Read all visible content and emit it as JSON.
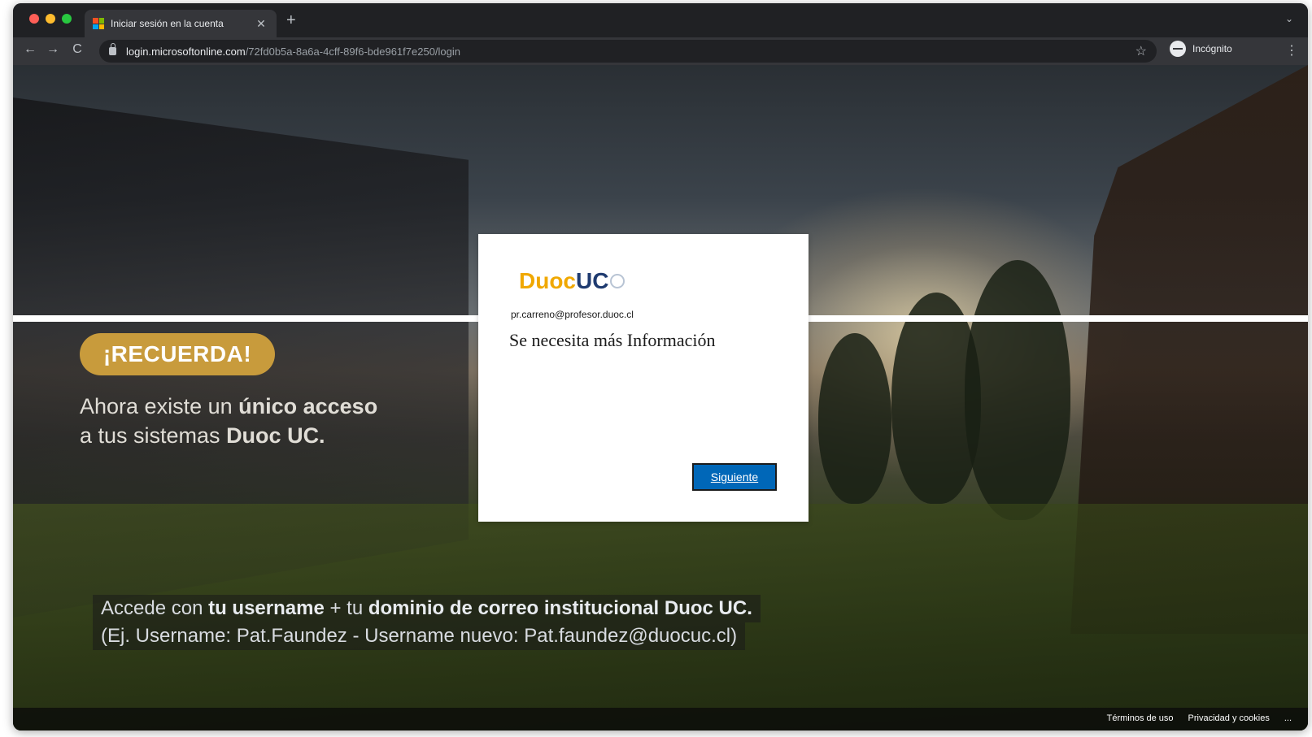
{
  "browser": {
    "tab_title": "Iniciar sesión en la cuenta",
    "tab_close": "✕",
    "new_tab": "+",
    "tab_menu": "⌄",
    "url_host": "login.microsoftonline.com",
    "url_path": "/72fd0b5a-8a6a-4cff-89f6-bde961f7e250/login",
    "incognito_label": "Incógnito",
    "back": "←",
    "forward": "→",
    "reload": "C",
    "star": "☆",
    "menu": "⋮"
  },
  "page": {
    "recuerda": "¡RECUERDA!",
    "tagline_line1_a": "Ahora existe un ",
    "tagline_line1_b": "único acceso",
    "tagline_line2_a": "a tus sistemas ",
    "tagline_line2_b": "Duoc UC.",
    "bottom_line1_a": "Accede con ",
    "bottom_line1_b": "tu username",
    "bottom_line1_c": " + tu ",
    "bottom_line1_d": "dominio de correo institucional Duoc UC.",
    "bottom_line2": "(Ej. Username: Pat.Faundez - Username nuevo: Pat.faundez@duocuc.cl)"
  },
  "login": {
    "brand_duoc": "Duoc",
    "brand_uc": "UC",
    "email": "pr.carreno@profesor.duoc.cl",
    "heading": "Se necesita más Información",
    "next_button": "Siguiente"
  },
  "footer": {
    "terms": "Términos de uso",
    "privacy": "Privacidad y cookies",
    "more": "..."
  },
  "colors": {
    "brand_gold": "#f0a800",
    "brand_navy": "#1f3b70",
    "button_blue": "#0067b8",
    "recuerda_gold": "#c89b3c"
  }
}
